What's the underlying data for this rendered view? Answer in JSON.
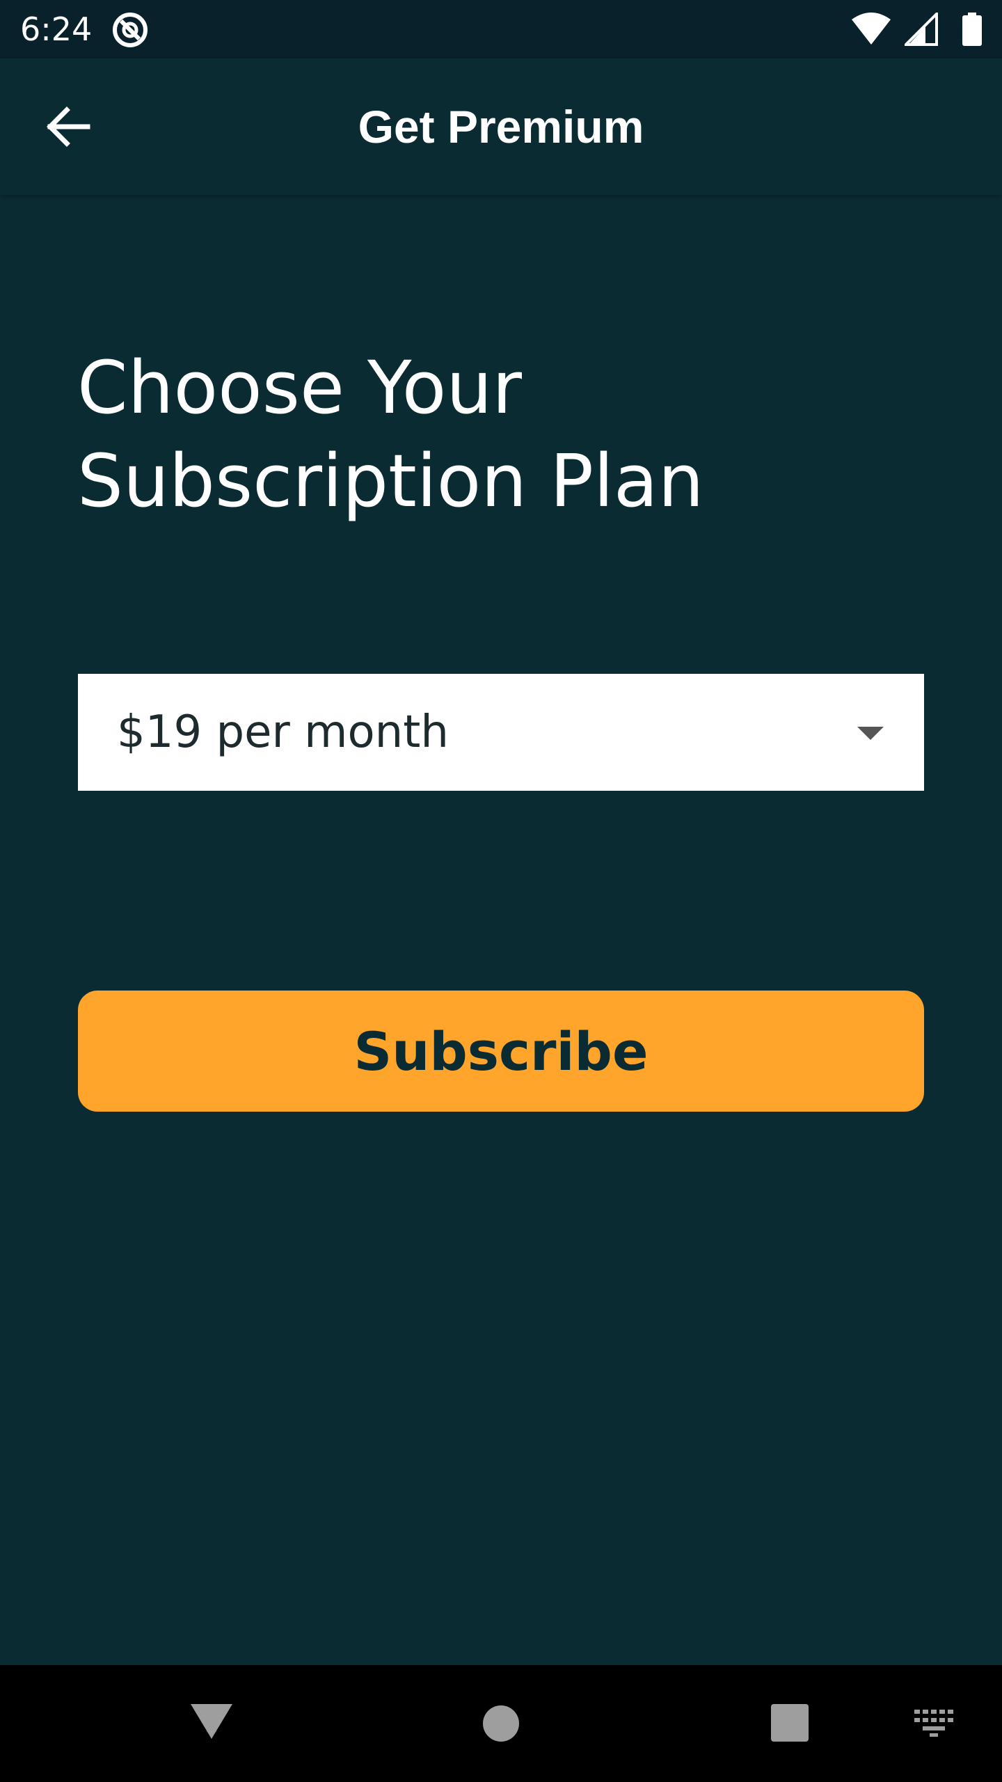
{
  "status_bar": {
    "time": "6:24",
    "icons": [
      "app-notification-icon",
      "wifi-icon",
      "cell-signal-icon",
      "battery-icon"
    ]
  },
  "app_bar": {
    "back_icon": "arrow-back-icon",
    "title": "Get Premium"
  },
  "main": {
    "headline": "Choose Your\nSubscription Plan",
    "plan_select": {
      "selected_value": "$19 per month",
      "icon": "dropdown-arrow-icon"
    },
    "subscribe_label": "Subscribe"
  },
  "nav_bar": {
    "icons": [
      "nav-back-icon",
      "nav-home-icon",
      "nav-recents-icon",
      "keyboard-icon"
    ]
  },
  "colors": {
    "background": "#0b2b33",
    "status_bar": "#08212a",
    "accent": "#ffa52b",
    "select_background": "#ffffff",
    "nav_bar": "#000000"
  }
}
